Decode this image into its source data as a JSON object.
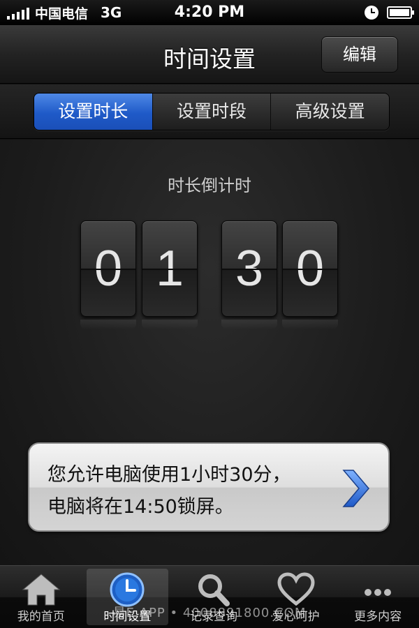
{
  "status_bar": {
    "carrier": "中国电信",
    "network": "3G",
    "time": "4:20 PM",
    "battery_level": 1.0,
    "icons": [
      "signal-icon",
      "alarm-icon",
      "battery-icon"
    ]
  },
  "nav": {
    "title": "时间设置",
    "edit_label": "编辑"
  },
  "segments": [
    {
      "label": "设置时长",
      "active": true
    },
    {
      "label": "设置时段",
      "active": false
    },
    {
      "label": "高级设置",
      "active": false
    }
  ],
  "countdown": {
    "label": "时长倒计时",
    "digits": [
      "0",
      "1",
      "3",
      "0"
    ]
  },
  "info": {
    "line1": "您允许电脑使用1小时30分，",
    "line2": "电脑将在14:50锁屏。",
    "icon": "chevron-right-icon"
  },
  "tabs": [
    {
      "label": "我的首页",
      "icon": "home-icon",
      "active": false
    },
    {
      "label": "时间设置",
      "icon": "clock-icon",
      "active": true
    },
    {
      "label": "记录查询",
      "icon": "search-icon",
      "active": false
    },
    {
      "label": "爱心呵护",
      "icon": "heart-icon",
      "active": false
    },
    {
      "label": "更多内容",
      "icon": "more-icon",
      "active": false
    }
  ],
  "watermark": "易E APP • 4008891800.COM",
  "colors": {
    "accent_blue": "#2f6fd6",
    "arrow_blue": "#3a7ee0"
  }
}
